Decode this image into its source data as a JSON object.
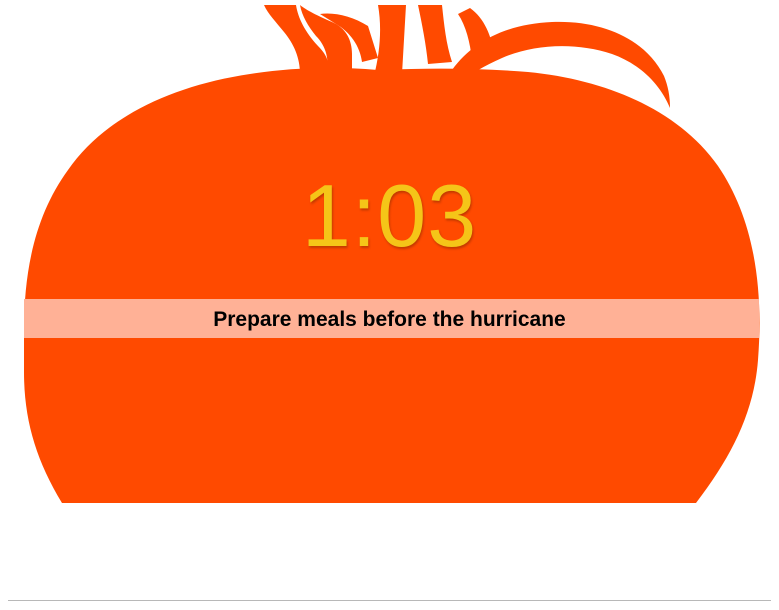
{
  "timer": {
    "remaining": "1:03"
  },
  "task": {
    "label": "Prepare meals before the hurricane"
  },
  "colors": {
    "tomato": "#ff4a00",
    "timer_text": "#f5c518",
    "task_band": "#ffb196",
    "task_text": "#000000"
  }
}
